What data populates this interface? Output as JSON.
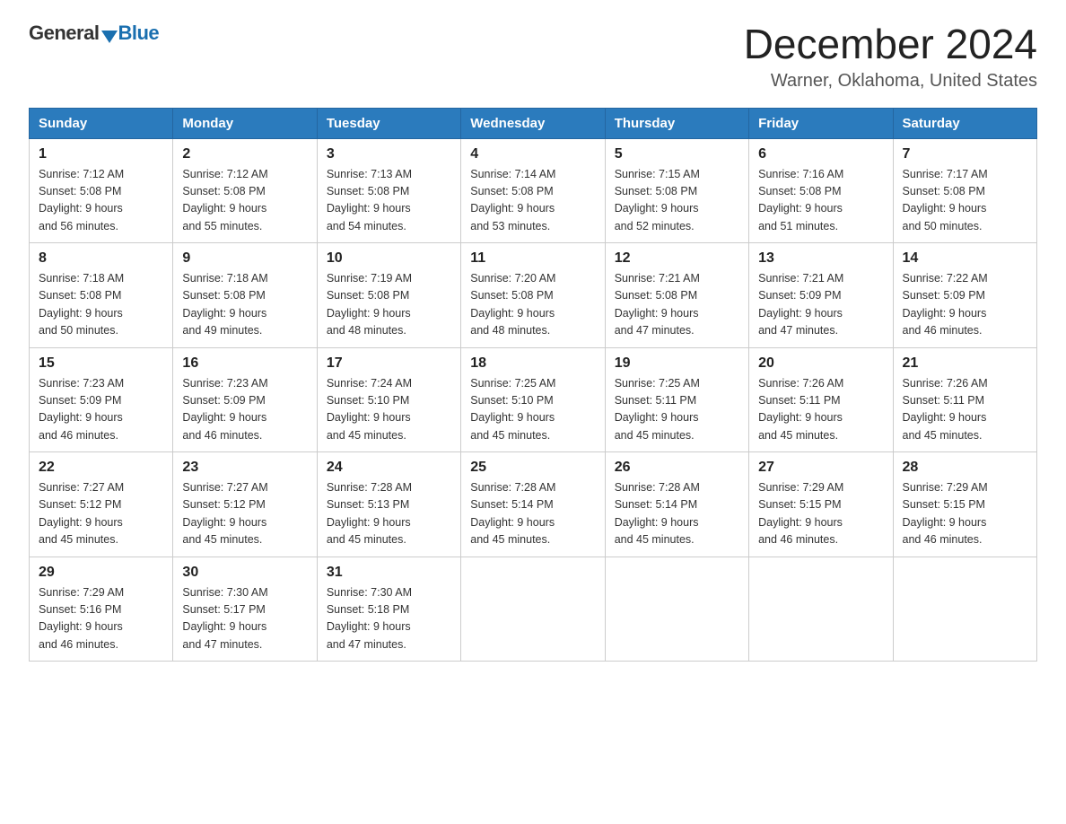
{
  "logo": {
    "text_general": "General",
    "text_blue": "Blue",
    "arrow": "▲"
  },
  "title": "December 2024",
  "location": "Warner, Oklahoma, United States",
  "days_of_week": [
    "Sunday",
    "Monday",
    "Tuesday",
    "Wednesday",
    "Thursday",
    "Friday",
    "Saturday"
  ],
  "weeks": [
    [
      {
        "day": "1",
        "sunrise": "7:12 AM",
        "sunset": "5:08 PM",
        "daylight": "9 hours and 56 minutes."
      },
      {
        "day": "2",
        "sunrise": "7:12 AM",
        "sunset": "5:08 PM",
        "daylight": "9 hours and 55 minutes."
      },
      {
        "day": "3",
        "sunrise": "7:13 AM",
        "sunset": "5:08 PM",
        "daylight": "9 hours and 54 minutes."
      },
      {
        "day": "4",
        "sunrise": "7:14 AM",
        "sunset": "5:08 PM",
        "daylight": "9 hours and 53 minutes."
      },
      {
        "day": "5",
        "sunrise": "7:15 AM",
        "sunset": "5:08 PM",
        "daylight": "9 hours and 52 minutes."
      },
      {
        "day": "6",
        "sunrise": "7:16 AM",
        "sunset": "5:08 PM",
        "daylight": "9 hours and 51 minutes."
      },
      {
        "day": "7",
        "sunrise": "7:17 AM",
        "sunset": "5:08 PM",
        "daylight": "9 hours and 50 minutes."
      }
    ],
    [
      {
        "day": "8",
        "sunrise": "7:18 AM",
        "sunset": "5:08 PM",
        "daylight": "9 hours and 50 minutes."
      },
      {
        "day": "9",
        "sunrise": "7:18 AM",
        "sunset": "5:08 PM",
        "daylight": "9 hours and 49 minutes."
      },
      {
        "day": "10",
        "sunrise": "7:19 AM",
        "sunset": "5:08 PM",
        "daylight": "9 hours and 48 minutes."
      },
      {
        "day": "11",
        "sunrise": "7:20 AM",
        "sunset": "5:08 PM",
        "daylight": "9 hours and 48 minutes."
      },
      {
        "day": "12",
        "sunrise": "7:21 AM",
        "sunset": "5:08 PM",
        "daylight": "9 hours and 47 minutes."
      },
      {
        "day": "13",
        "sunrise": "7:21 AM",
        "sunset": "5:09 PM",
        "daylight": "9 hours and 47 minutes."
      },
      {
        "day": "14",
        "sunrise": "7:22 AM",
        "sunset": "5:09 PM",
        "daylight": "9 hours and 46 minutes."
      }
    ],
    [
      {
        "day": "15",
        "sunrise": "7:23 AM",
        "sunset": "5:09 PM",
        "daylight": "9 hours and 46 minutes."
      },
      {
        "day": "16",
        "sunrise": "7:23 AM",
        "sunset": "5:09 PM",
        "daylight": "9 hours and 46 minutes."
      },
      {
        "day": "17",
        "sunrise": "7:24 AM",
        "sunset": "5:10 PM",
        "daylight": "9 hours and 45 minutes."
      },
      {
        "day": "18",
        "sunrise": "7:25 AM",
        "sunset": "5:10 PM",
        "daylight": "9 hours and 45 minutes."
      },
      {
        "day": "19",
        "sunrise": "7:25 AM",
        "sunset": "5:11 PM",
        "daylight": "9 hours and 45 minutes."
      },
      {
        "day": "20",
        "sunrise": "7:26 AM",
        "sunset": "5:11 PM",
        "daylight": "9 hours and 45 minutes."
      },
      {
        "day": "21",
        "sunrise": "7:26 AM",
        "sunset": "5:11 PM",
        "daylight": "9 hours and 45 minutes."
      }
    ],
    [
      {
        "day": "22",
        "sunrise": "7:27 AM",
        "sunset": "5:12 PM",
        "daylight": "9 hours and 45 minutes."
      },
      {
        "day": "23",
        "sunrise": "7:27 AM",
        "sunset": "5:12 PM",
        "daylight": "9 hours and 45 minutes."
      },
      {
        "day": "24",
        "sunrise": "7:28 AM",
        "sunset": "5:13 PM",
        "daylight": "9 hours and 45 minutes."
      },
      {
        "day": "25",
        "sunrise": "7:28 AM",
        "sunset": "5:14 PM",
        "daylight": "9 hours and 45 minutes."
      },
      {
        "day": "26",
        "sunrise": "7:28 AM",
        "sunset": "5:14 PM",
        "daylight": "9 hours and 45 minutes."
      },
      {
        "day": "27",
        "sunrise": "7:29 AM",
        "sunset": "5:15 PM",
        "daylight": "9 hours and 46 minutes."
      },
      {
        "day": "28",
        "sunrise": "7:29 AM",
        "sunset": "5:15 PM",
        "daylight": "9 hours and 46 minutes."
      }
    ],
    [
      {
        "day": "29",
        "sunrise": "7:29 AM",
        "sunset": "5:16 PM",
        "daylight": "9 hours and 46 minutes."
      },
      {
        "day": "30",
        "sunrise": "7:30 AM",
        "sunset": "5:17 PM",
        "daylight": "9 hours and 47 minutes."
      },
      {
        "day": "31",
        "sunrise": "7:30 AM",
        "sunset": "5:18 PM",
        "daylight": "9 hours and 47 minutes."
      },
      null,
      null,
      null,
      null
    ]
  ]
}
